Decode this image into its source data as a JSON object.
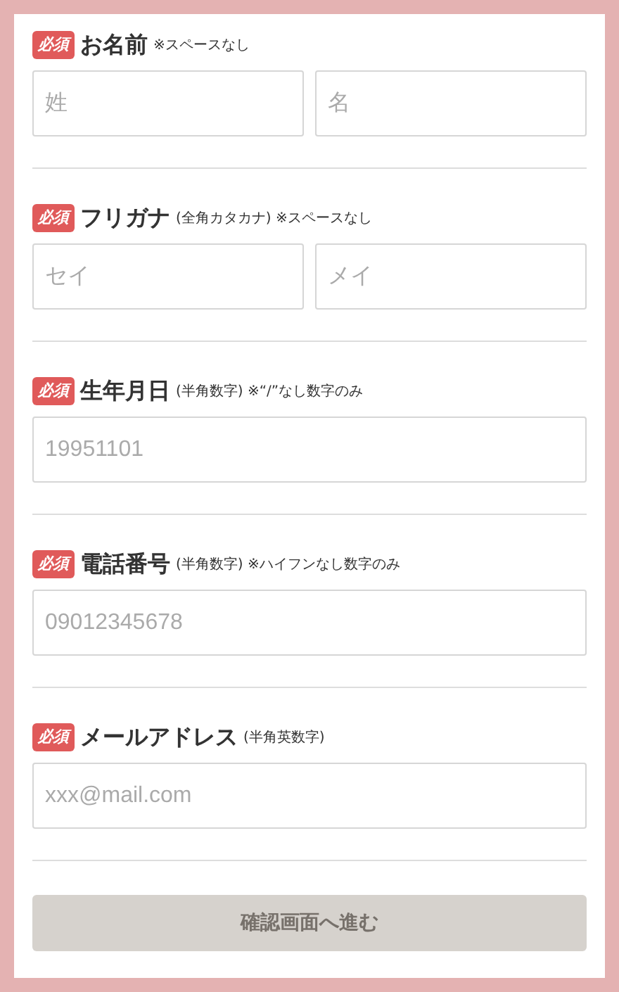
{
  "fields": [
    {
      "badge": "必須",
      "label": "お名前",
      "note": "※スペースなし",
      "inputs": [
        {
          "placeholder": "姓"
        },
        {
          "placeholder": "名"
        }
      ]
    },
    {
      "badge": "必須",
      "label": "フリガナ",
      "note": "(全角カタカナ) ※スペースなし",
      "inputs": [
        {
          "placeholder": "セイ"
        },
        {
          "placeholder": "メイ"
        }
      ]
    },
    {
      "badge": "必須",
      "label": "生年月日",
      "note": "(半角数字) ※“/”なし数字のみ",
      "inputs": [
        {
          "placeholder": "19951101"
        }
      ]
    },
    {
      "badge": "必須",
      "label": "電話番号",
      "note": "(半角数字) ※ハイフンなし数字のみ",
      "inputs": [
        {
          "placeholder": "09012345678"
        }
      ]
    },
    {
      "badge": "必須",
      "label": "メールアドレス",
      "note": "(半角英数字)",
      "inputs": [
        {
          "placeholder": "xxx@mail.com"
        }
      ]
    }
  ],
  "submit": {
    "label": "確認画面へ進む",
    "disabled": true
  }
}
